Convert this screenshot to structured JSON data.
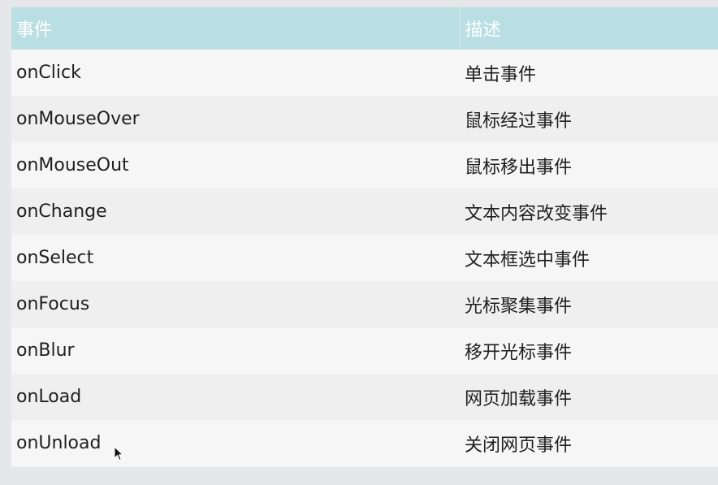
{
  "table": {
    "headers": [
      "事件",
      "描述"
    ],
    "rows": [
      {
        "event": "onClick",
        "description": "单击事件"
      },
      {
        "event": "onMouseOver",
        "description": "鼠标经过事件"
      },
      {
        "event": "onMouseOut",
        "description": "鼠标移出事件"
      },
      {
        "event": "onChange",
        "description": "文本内容改变事件"
      },
      {
        "event": "onSelect",
        "description": "文本框选中事件"
      },
      {
        "event": "onFocus",
        "description": "光标聚集事件"
      },
      {
        "event": "onBlur",
        "description": "移开光标事件"
      },
      {
        "event": "onLoad",
        "description": "网页加载事件"
      },
      {
        "event": "onUnload",
        "description": "关闭网页事件"
      }
    ]
  },
  "colors": {
    "header_bg": "#b9dfe3",
    "header_text": "#ffffff",
    "row_text": "#1f1f1f"
  },
  "icons": {
    "pointer": "mouse-cursor-icon"
  }
}
